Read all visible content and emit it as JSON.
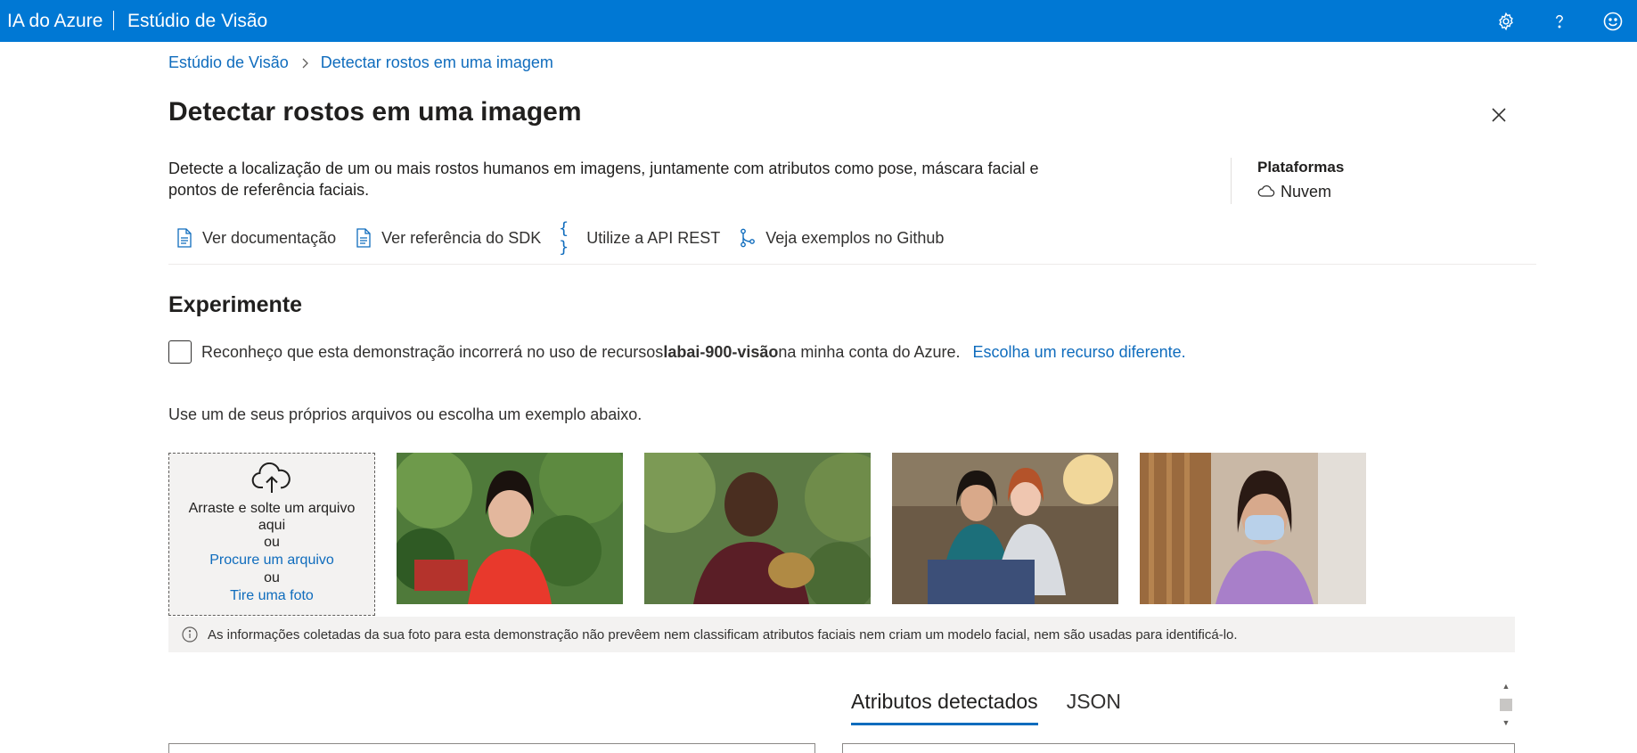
{
  "topbar": {
    "brand": "IA do Azure",
    "product": "Estúdio de Visão",
    "icons": [
      "gear-icon",
      "help-icon",
      "feedback-smile-icon"
    ]
  },
  "breadcrumb": {
    "home": "Estúdio de Visão",
    "current": "Detectar rostos em uma imagem"
  },
  "page": {
    "title": "Detectar rostos em uma imagem",
    "description": "Detecte a localização de um ou mais rostos humanos em imagens, juntamente com atributos como pose, máscara facial e pontos de referência faciais."
  },
  "platforms": {
    "title": "Plataformas",
    "item": "Nuvem",
    "item_icon": "cloud-icon"
  },
  "links": [
    {
      "label": "Ver documentação",
      "icon": "document-icon"
    },
    {
      "label": "Ver referência do SDK",
      "icon": "document-icon"
    },
    {
      "label": "Utilize a API REST",
      "icon": "braces-icon"
    },
    {
      "label": "Veja exemplos no Github",
      "icon": "branch-icon"
    }
  ],
  "experiment": {
    "title": "Experimente",
    "consent_prefix": "Reconheço que esta demonstração incorrerá no uso de recursos",
    "resource_name": "labai-900-visão",
    "consent_suffix": "na minha conta do Azure.",
    "choose_other": "Escolha um recurso diferente.",
    "checked": false
  },
  "samples": {
    "instruction": "Use um de seus próprios arquivos ou escolha um exemplo abaixo.",
    "dropzone": {
      "drag_text": "Arraste e solte um arquivo aqui",
      "or1": "ou",
      "browse": "Procure um arquivo",
      "or2": "ou",
      "photo": "Tire uma foto"
    }
  },
  "notice": {
    "text": "As informações coletadas da sua foto para esta demonstração não prevêem nem classificam atributos faciais nem criam um modelo facial, nem são usadas para identificá-lo."
  },
  "results": {
    "tabs": [
      "Atributos detectados",
      "JSON"
    ],
    "active_tab": 0
  },
  "colors": {
    "topbar": "#0078d4",
    "link": "#0f6cbd",
    "notice_bg": "#f3f2f1"
  }
}
